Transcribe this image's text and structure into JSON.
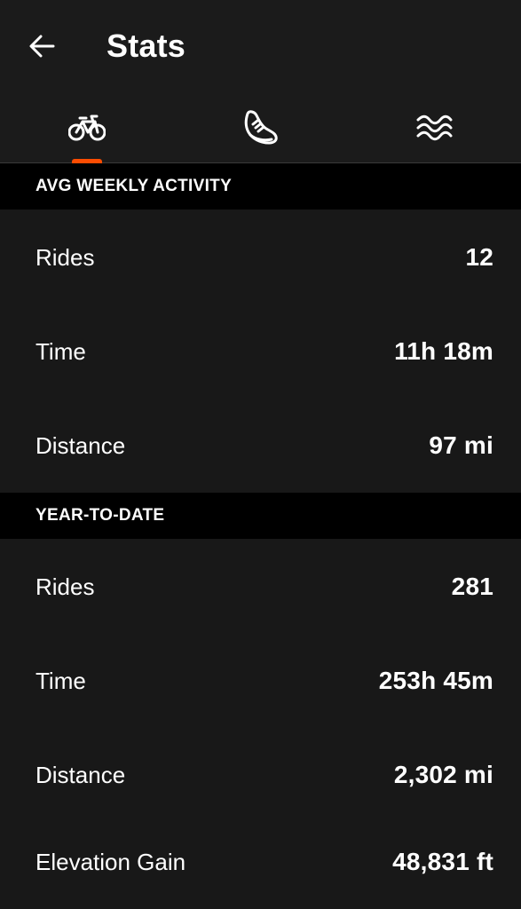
{
  "header": {
    "title": "Stats"
  },
  "tabs": [
    {
      "icon": "bicycle-icon",
      "active": true
    },
    {
      "icon": "shoe-icon",
      "active": false
    },
    {
      "icon": "water-waves-icon",
      "active": false
    }
  ],
  "colors": {
    "accent": "#fc4c02",
    "background": "#181818",
    "section_header_bg": "#000000"
  },
  "sections": {
    "weekly": {
      "title": "AVG WEEKLY ACTIVITY",
      "rows": [
        {
          "label": "Rides",
          "value": "12"
        },
        {
          "label": "Time",
          "value": "11h 18m"
        },
        {
          "label": "Distance",
          "value": "97 mi"
        }
      ]
    },
    "ytd": {
      "title": "YEAR-TO-DATE",
      "rows": [
        {
          "label": "Rides",
          "value": "281"
        },
        {
          "label": "Time",
          "value": "253h 45m"
        },
        {
          "label": "Distance",
          "value": "2,302 mi"
        },
        {
          "label": "Elevation Gain",
          "value": "48,831 ft"
        }
      ]
    }
  }
}
